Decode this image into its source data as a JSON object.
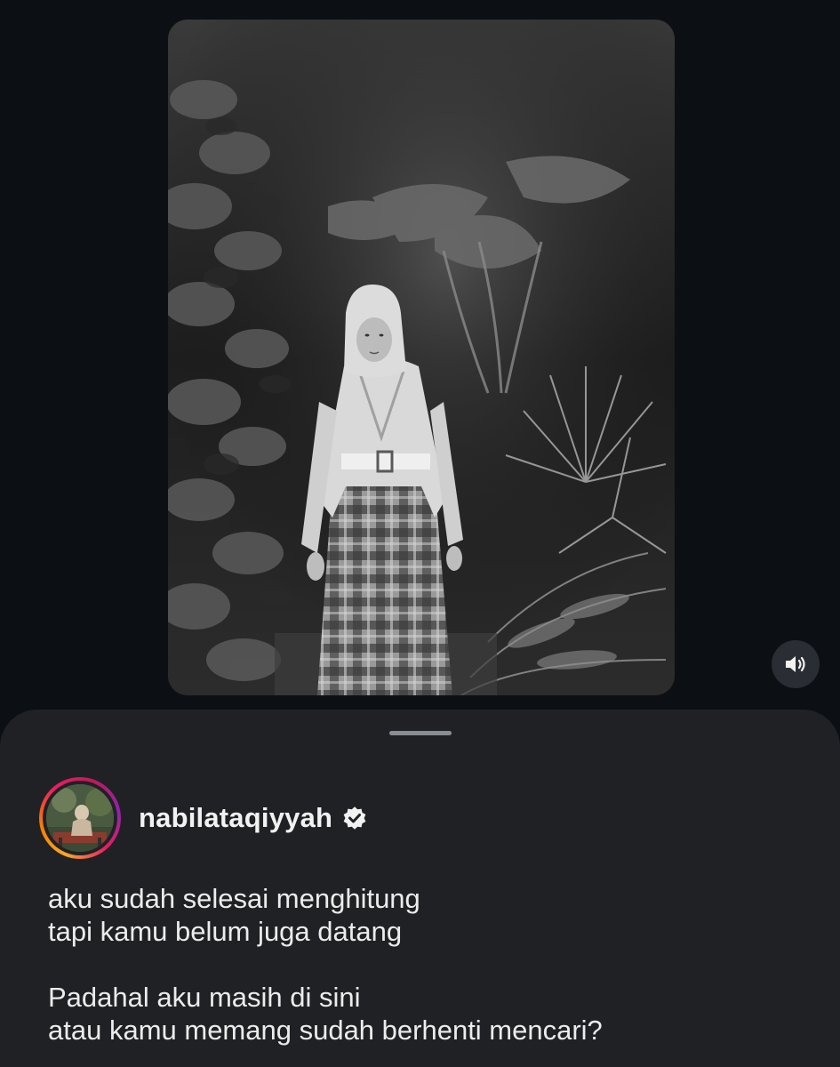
{
  "post": {
    "media_type": "photo",
    "media_style": "black-and-white",
    "sound_icon": "speaker-icon"
  },
  "author": {
    "username": "nabilataqiyyah",
    "verified": true,
    "verified_icon": "verified-badge-icon",
    "story_ring_colors": [
      "#f9a825",
      "#e91e63",
      "#8e24aa"
    ]
  },
  "caption": {
    "stanza1": {
      "line1": "aku sudah selesai menghitung",
      "line2": "tapi kamu belum juga datang"
    },
    "stanza2": {
      "line1": "Padahal aku masih di sini",
      "line2": "atau kamu memang sudah berhenti mencari?"
    }
  },
  "colors": {
    "background": "#0c1015",
    "sheet": "#202125",
    "text": "#ececec"
  }
}
